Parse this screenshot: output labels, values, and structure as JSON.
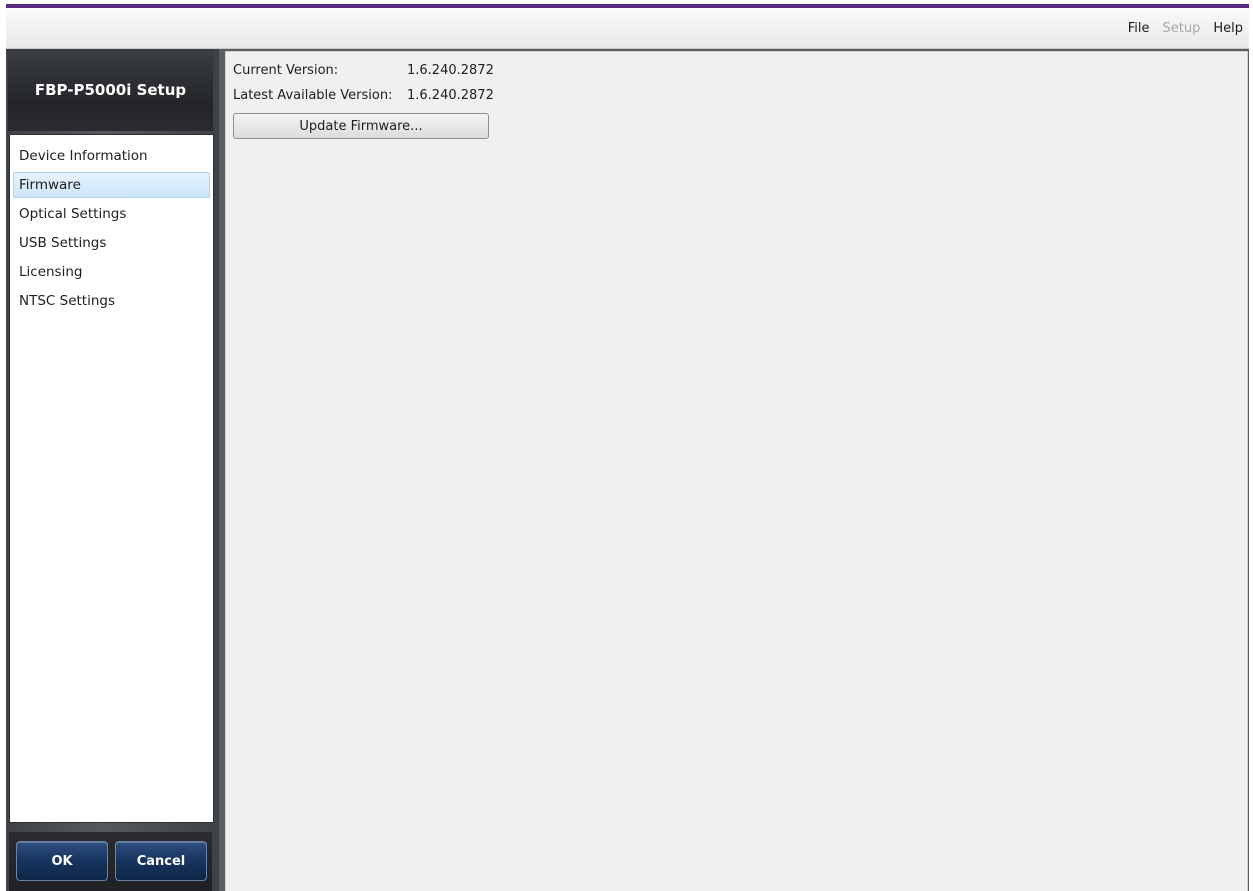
{
  "menubar": {
    "items": [
      {
        "label": "File",
        "enabled": true
      },
      {
        "label": "Setup",
        "enabled": false
      },
      {
        "label": "Help",
        "enabled": true
      }
    ]
  },
  "sidebar": {
    "title": "FBP-P5000i Setup",
    "items": [
      {
        "label": "Device Information",
        "selected": false
      },
      {
        "label": "Firmware",
        "selected": true
      },
      {
        "label": "Optical Settings",
        "selected": false
      },
      {
        "label": "USB Settings",
        "selected": false
      },
      {
        "label": "Licensing",
        "selected": false
      },
      {
        "label": "NTSC Settings",
        "selected": false
      }
    ],
    "ok_label": "OK",
    "cancel_label": "Cancel"
  },
  "firmware": {
    "current_version_label": "Current Version:",
    "current_version_value": "1.6.240.2872",
    "latest_version_label": "Latest Available Version:",
    "latest_version_value": "1.6.240.2872",
    "update_button_label": "Update Firmware..."
  },
  "colors": {
    "accent_bar": "#5a2a7e",
    "selected_item_bg": "#cde6fa",
    "button_blue": "#17345f"
  }
}
